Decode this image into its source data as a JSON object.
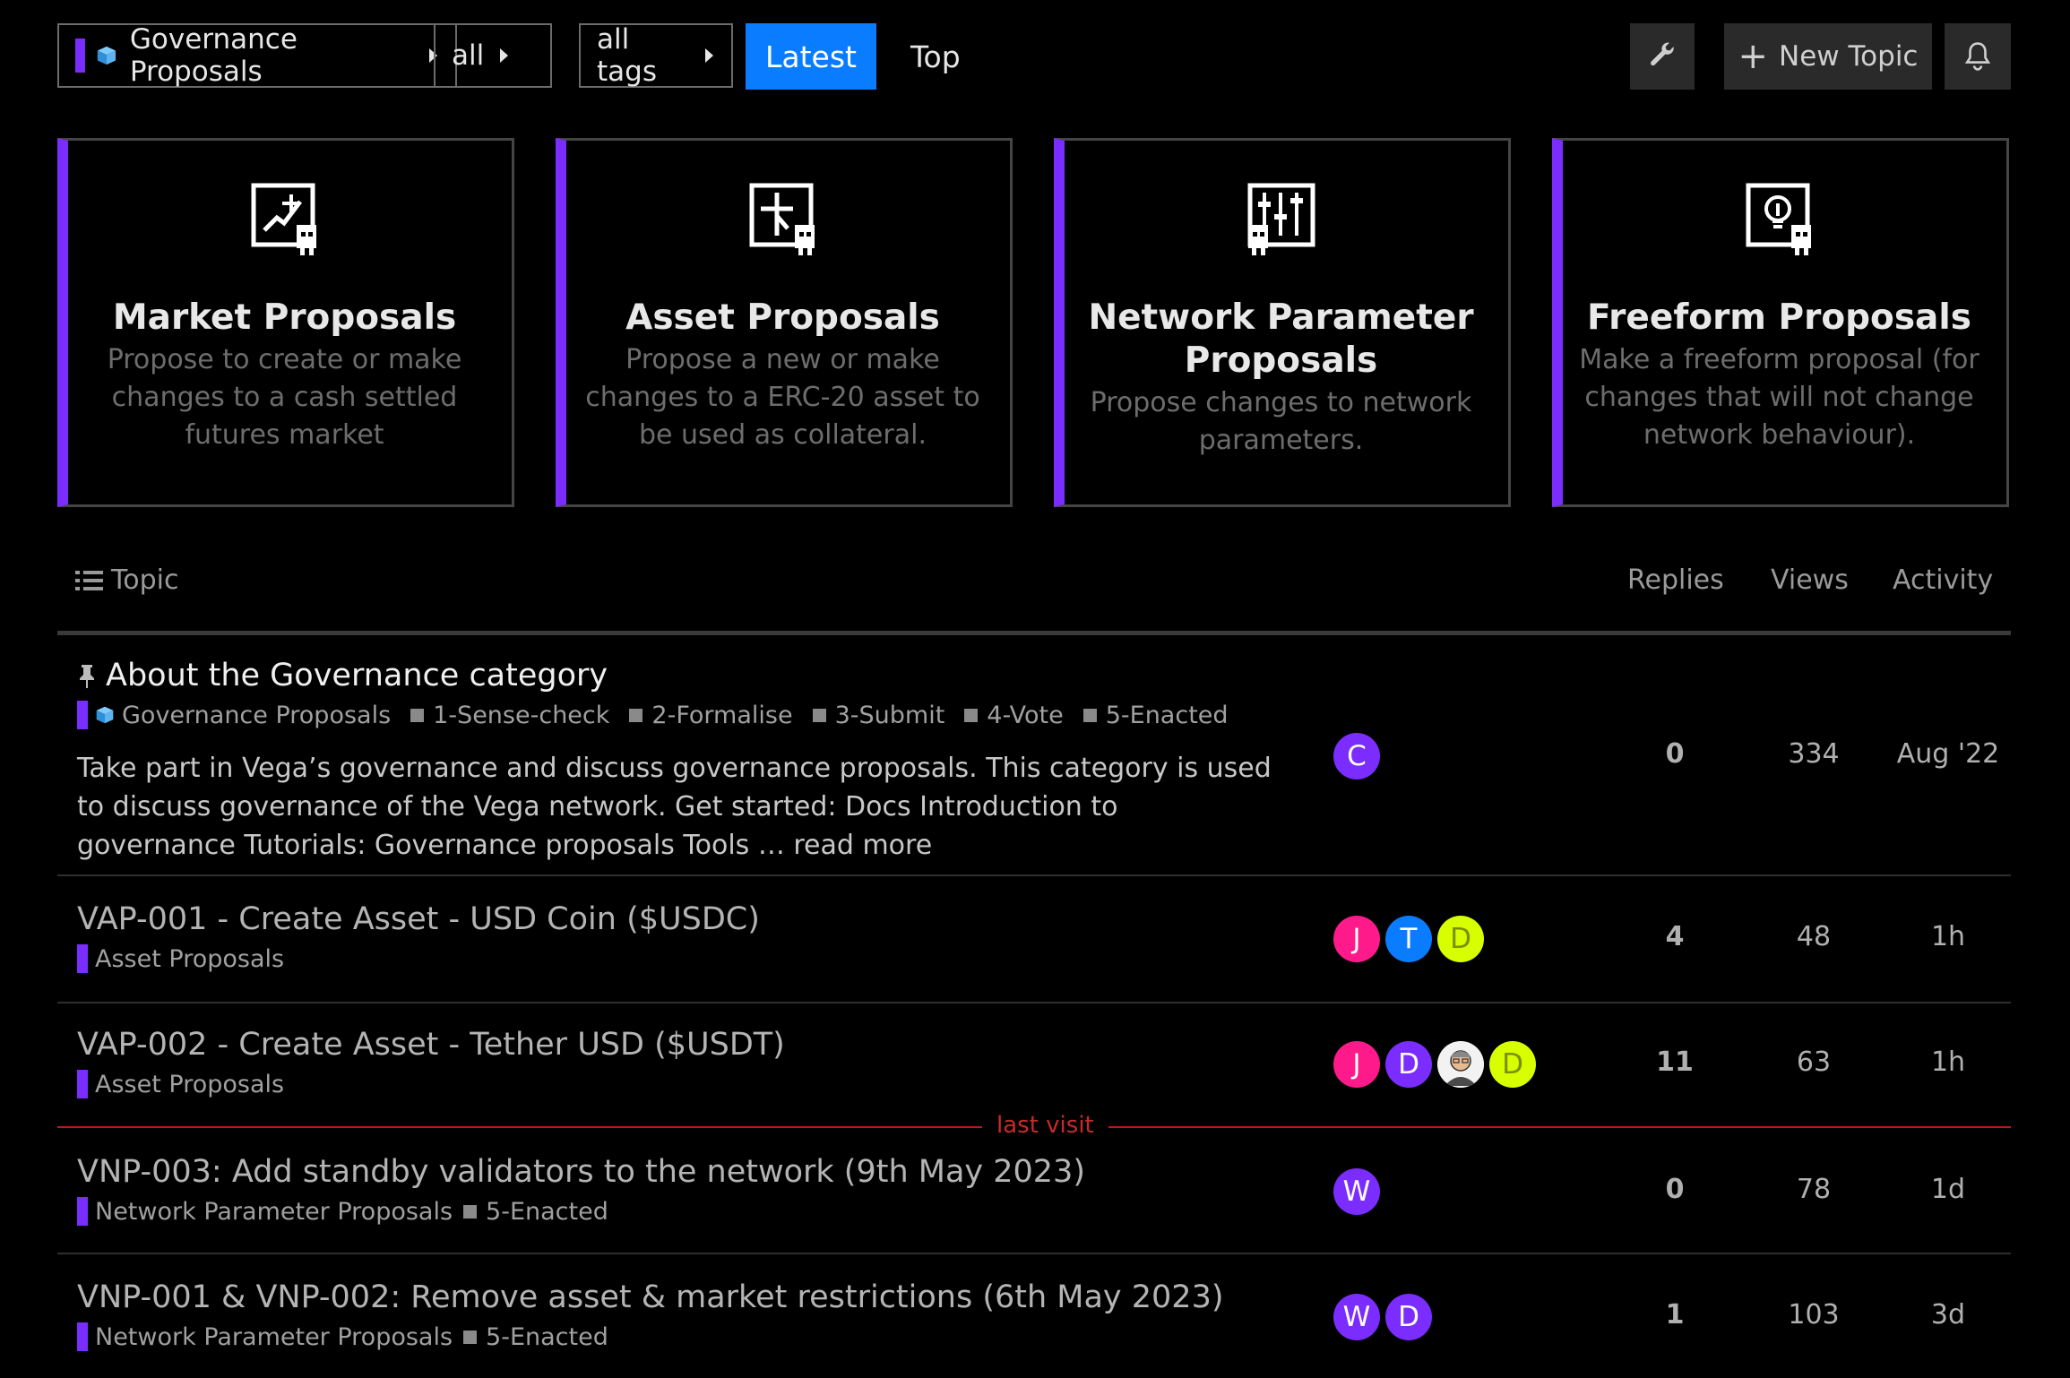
{
  "nav": {
    "category": "Governance Proposals",
    "all": "all",
    "tags": "all tags",
    "latest": "Latest",
    "top": "Top",
    "new_topic": "New Topic",
    "accent": "#7b2cff",
    "active": "#0a7cff"
  },
  "categories": [
    {
      "title": "Market Proposals",
      "desc": "Propose to create or make changes to a cash settled futures market"
    },
    {
      "title": "Asset Proposals",
      "desc": "Propose a new or make changes to a ERC-20 asset to be used as collateral."
    },
    {
      "title": "Network Parameter Proposals",
      "desc": "Propose changes to network parameters."
    },
    {
      "title": "Freeform Proposals",
      "desc": "Make a freeform proposal (for changes that will not change network behaviour)."
    }
  ],
  "list_header": {
    "topic": "Topic",
    "replies": "Replies",
    "views": "Views",
    "activity": "Activity"
  },
  "topics": [
    {
      "title": "About the Governance category",
      "category": "Governance Proposals",
      "tags": [
        "1-Sense-check",
        "2-Formalise",
        "3-Submit",
        "4-Vote",
        "5-Enacted"
      ],
      "excerpt": "Take part in Vega’s governance and discuss governance proposals. This category is used to discuss governance of the Vega network. Get started: Docs Introduction to governance Tutorials: Governance proposals Tools … read more",
      "avatars": [
        "C"
      ],
      "replies": "0",
      "views": "334",
      "activity": "Aug '22"
    },
    {
      "title": "VAP-001 - Create Asset - USD Coin ($USDC)",
      "category": "Asset Proposals",
      "avatars": [
        "J",
        "T",
        "D"
      ],
      "replies": "4",
      "views": "48",
      "activity": "1h"
    },
    {
      "title": "VAP-002 - Create Asset - Tether USD ($USDT)",
      "category": "Asset Proposals",
      "avatars": [
        "J",
        "D",
        "D"
      ],
      "replies": "11",
      "views": "63",
      "activity": "1h"
    },
    {
      "title": "VNP-003: Add standby validators to the network (9th May 2023)",
      "category": "Network Parameter Proposals",
      "tags": [
        "5-Enacted"
      ],
      "avatars": [
        "W"
      ],
      "replies": "0",
      "views": "78",
      "activity": "1d"
    },
    {
      "title": "VNP-001 & VNP-002: Remove asset & market restrictions (6th May 2023)",
      "category": "Network Parameter Proposals",
      "tags": [
        "5-Enacted"
      ],
      "avatars": [
        "W",
        "D"
      ],
      "replies": "1",
      "views": "103",
      "activity": "3d"
    }
  ],
  "last_visit": "last visit"
}
